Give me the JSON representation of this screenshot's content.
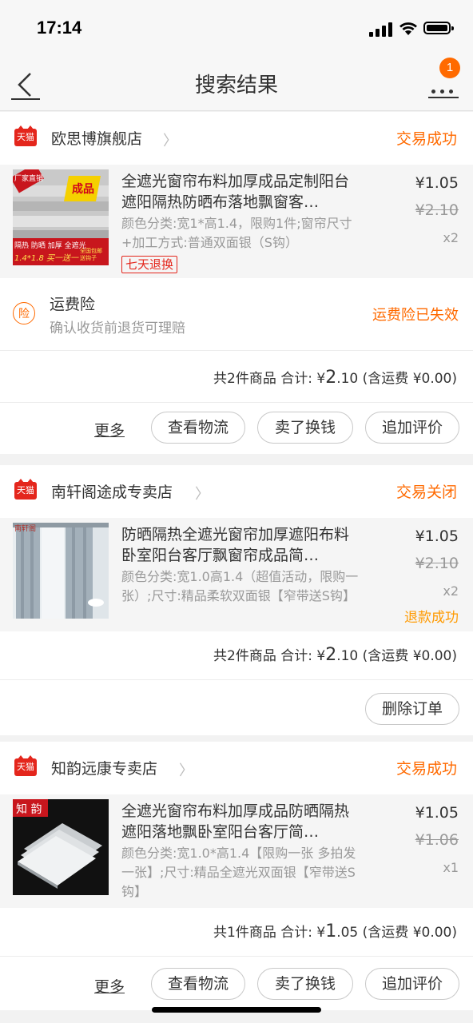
{
  "status_bar": {
    "time": "17:14"
  },
  "nav": {
    "title": "搜索结果",
    "badge": "1"
  },
  "orders": [
    {
      "shop": "欧思博旗舰店",
      "shop_badge": "天猫",
      "status": "交易成功",
      "item": {
        "title": "全遮光窗帘布料加厚成品定制阳台遮阳隔热防晒布落地飘窗客…",
        "spec": "颜色分类:宽1*高1.4，限购1件;窗帘尺寸+加工方式:普通双面银（S钩）",
        "price": "¥1.05",
        "original_price": "¥2.10",
        "qty": "x2",
        "tag": "七天退换",
        "thumb_texts": [
          "厂家直销",
          "成品",
          "隔热 防晒 加厚 全遮光",
          "1.4*1.8 买一送一",
          "全国包邮 送钩子"
        ]
      },
      "insurance": {
        "icon": "险",
        "title": "运费险",
        "subtitle": "确认收货前退货可理赔",
        "status": "运费险已失效"
      },
      "total": {
        "prefix": "共2件商品 合计: ¥",
        "int": "2",
        "dec": ".10",
        "suffix": " (含运费 ¥0.00)"
      },
      "actions": {
        "more": "更多",
        "b1": "查看物流",
        "b2": "卖了换钱",
        "b3": "追加评价"
      }
    },
    {
      "shop": "南轩阁途成专卖店",
      "shop_badge": "天猫",
      "status": "交易关闭",
      "item": {
        "title": "防晒隔热全遮光窗帘加厚遮阳布料卧室阳台客厅飘窗帘成品简…",
        "spec": "颜色分类:宽1.0高1.4（超值活动，限购一张）;尺寸:精品柔软双面银【窄带送S钩】",
        "price": "¥1.05",
        "original_price": "¥2.10",
        "qty": "x2",
        "refund": "退款成功",
        "thumb_texts": [
          "南轩阁"
        ]
      },
      "total": {
        "prefix": "共2件商品 合计: ¥",
        "int": "2",
        "dec": ".10",
        "suffix": " (含运费 ¥0.00)"
      },
      "actions": {
        "delete": "删除订单"
      }
    },
    {
      "shop": "知韵远康专卖店",
      "shop_badge": "天猫",
      "status": "交易成功",
      "item": {
        "title": "全遮光窗帘布料加厚成品防晒隔热遮阳落地飘卧室阳台客厅简…",
        "spec": "颜色分类:宽1.0*高1.4【限购一张 多拍发一张】;尺寸:精品全遮光双面银【窄带送S钩】",
        "price": "¥1.05",
        "original_price": "¥1.06",
        "qty": "x1",
        "thumb_texts": [
          "知 韵"
        ]
      },
      "total": {
        "prefix": "共1件商品 合计: ¥",
        "int": "1",
        "dec": ".05",
        "suffix": " (含运费 ¥0.00)"
      },
      "actions": {
        "more": "更多",
        "b1": "查看物流",
        "b2": "卖了换钱",
        "b3": "追加评价"
      }
    }
  ]
}
